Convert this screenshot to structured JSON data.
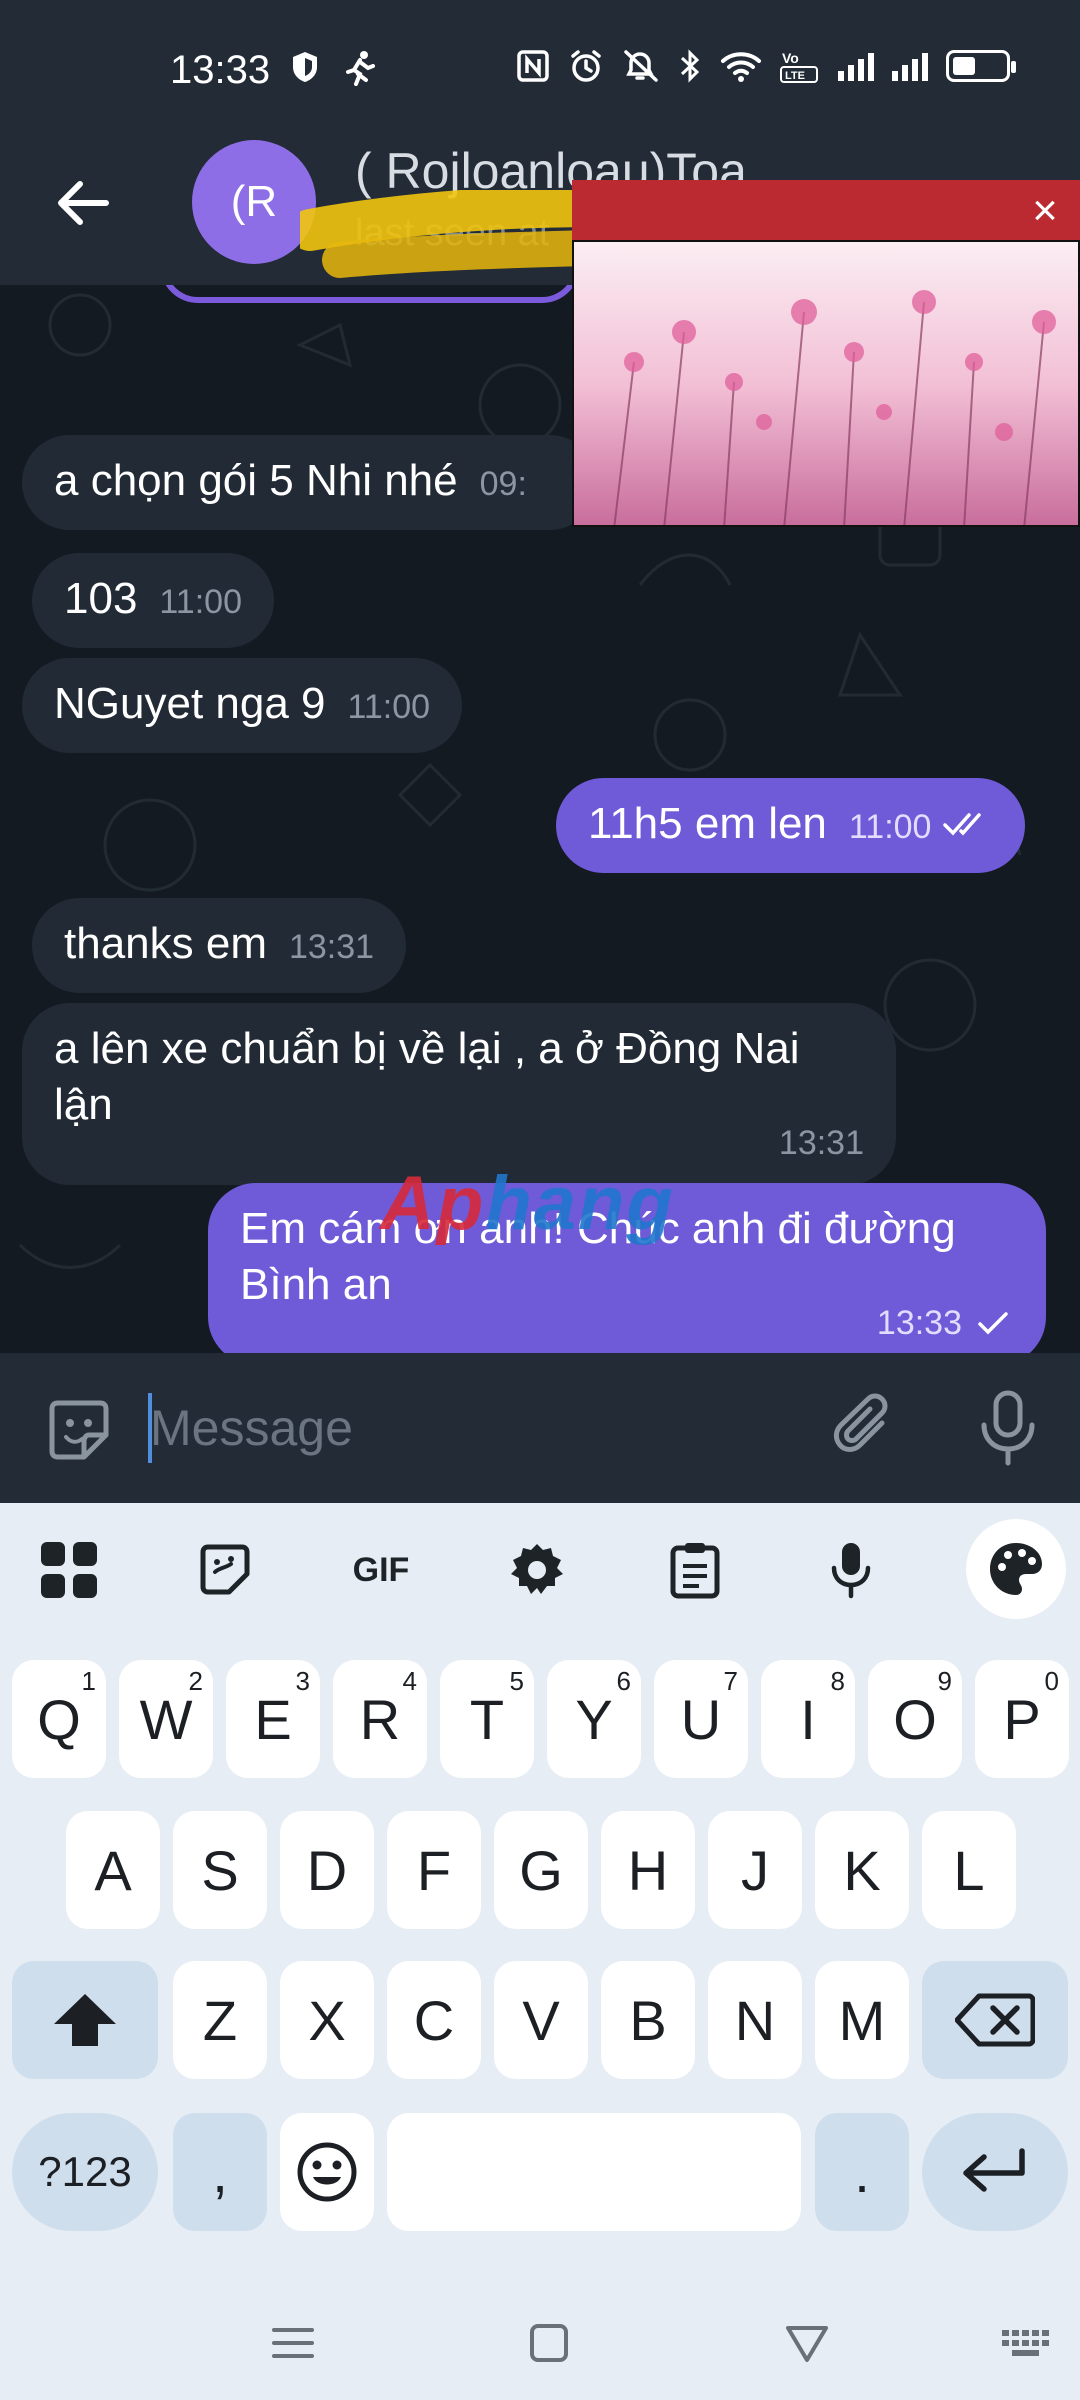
{
  "status_bar": {
    "time": "13:33",
    "right_icons": [
      "nfc-icon",
      "alarm-icon",
      "mute-icon",
      "bluetooth-icon",
      "wifi-icon",
      "volte-icon",
      "signal-icon",
      "signal-icon",
      "battery-icon"
    ],
    "volte_label": "Vo\nLTE"
  },
  "header": {
    "avatar_initials": "(R",
    "title": "( Rojloanloau)Toa",
    "subtitle": "last seen at"
  },
  "messages": [
    {
      "text": "a chọn gói 5 Nhi nhé",
      "time": "09:",
      "direction": "in"
    },
    {
      "text": "103",
      "time": "11:00",
      "direction": "in"
    },
    {
      "text": "NGuyet nga 9",
      "time": "11:00",
      "direction": "in"
    },
    {
      "text": "11h5 em len",
      "time": "11:00",
      "direction": "out",
      "status": "read"
    },
    {
      "text": "thanks em",
      "time": "13:31",
      "direction": "in"
    },
    {
      "text": "a lên xe chuẩn bị về lại , a ở Đồng Nai lận",
      "time": "13:31",
      "direction": "in"
    },
    {
      "text": "Em cám ơn anh! Chúc anh đi đường Bình an",
      "time": "13:33",
      "direction": "out",
      "status": "sent"
    }
  ],
  "watermark": {
    "part1": "Ap",
    "part2": "hang"
  },
  "composer": {
    "placeholder": "Message"
  },
  "keyboard": {
    "toolbar": [
      "apps-grid-icon",
      "sticker-icon",
      "GIF",
      "settings-gear-icon",
      "clipboard-icon",
      "mic-icon",
      "palette-icon"
    ],
    "gif_label": "GIF",
    "row1": [
      {
        "k": "Q",
        "h": "1"
      },
      {
        "k": "W",
        "h": "2"
      },
      {
        "k": "E",
        "h": "3"
      },
      {
        "k": "R",
        "h": "4"
      },
      {
        "k": "T",
        "h": "5"
      },
      {
        "k": "Y",
        "h": "6"
      },
      {
        "k": "U",
        "h": "7"
      },
      {
        "k": "I",
        "h": "8"
      },
      {
        "k": "O",
        "h": "9"
      },
      {
        "k": "P",
        "h": "0"
      }
    ],
    "row2": [
      "A",
      "S",
      "D",
      "F",
      "G",
      "H",
      "J",
      "K",
      "L"
    ],
    "row3": [
      "Z",
      "X",
      "C",
      "V",
      "B",
      "N",
      "M"
    ],
    "symbols_key": "?123",
    "comma_key": ",",
    "period_key": "."
  },
  "colors": {
    "header_bg": "#222b36",
    "chat_bg": "#131a22",
    "bubble_in": "#222b35",
    "bubble_out": "#6f5ad8",
    "keyboard_bg": "#e7edf4",
    "key_special": "#cfdeed"
  }
}
